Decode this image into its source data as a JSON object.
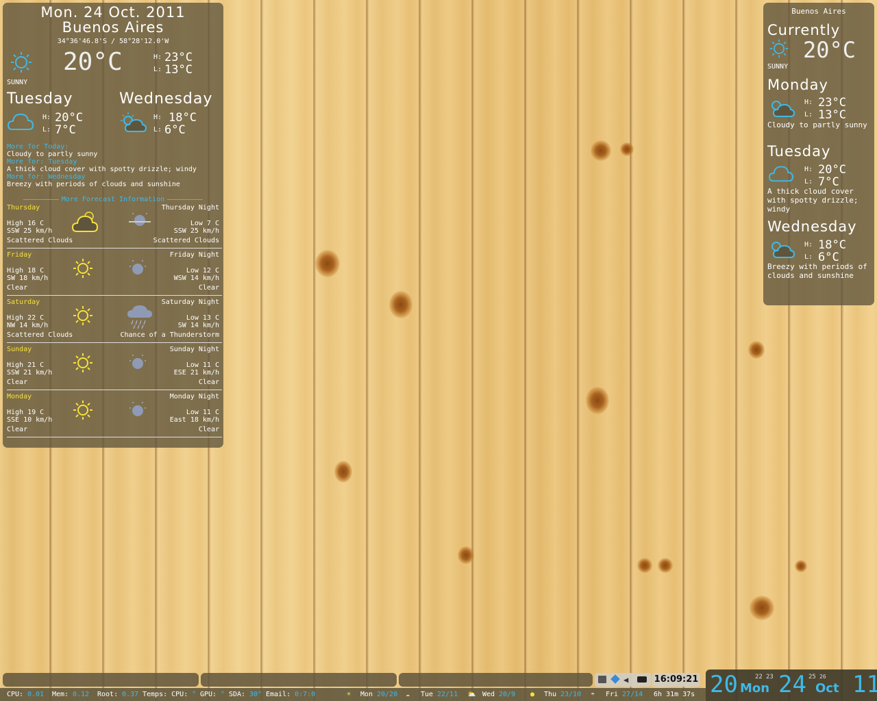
{
  "left": {
    "date": "Mon. 24 Oct. 2011",
    "city": "Buenos Aires",
    "coords": "34°36'46.8'S / 58°28'12.0'W",
    "current_temp": "20°C",
    "current_high": "23°C",
    "current_low": "13°C",
    "current_cond": "SUNNY",
    "h_label": "H:",
    "l_label": "L:",
    "day2": {
      "name": "Tuesday",
      "high": "20°C",
      "low": "7°C"
    },
    "day3": {
      "name": "Wednesday",
      "high": "18°C",
      "low": "6°C"
    },
    "more_today_label": "More for Today:",
    "more_today_text": "Cloudy to partly sunny",
    "more_tue_label": "More for: Tuesday",
    "more_tue_text": "A thick cloud cover with spotty drizzle; windy",
    "more_wed_label": "More for: Wednesday",
    "more_wed_text": "Breezy with periods of clouds and sunshine",
    "more_forecast": "More Forecast Information",
    "forecast": [
      {
        "day": "Thursday",
        "night": "Thursday Night",
        "high": "High 16 C",
        "wind": "SSW 25 km/h",
        "cond": "Scattered Clouds",
        "low": "Low 7 C",
        "nwind": "SSW  25 km/h",
        "ncond": "Scattered Clouds",
        "icon": "cloud-icon",
        "nicon": "moon-cloud-icon"
      },
      {
        "day": "Friday",
        "night": "Friday Night",
        "high": "High 18 C",
        "wind": "SW 18 km/h",
        "cond": "Clear",
        "low": "Low 12 C",
        "nwind": "WSW  14 km/h",
        "ncond": "Clear",
        "icon": "sun-icon",
        "nicon": "moon-icon"
      },
      {
        "day": "Saturday",
        "night": "Saturday Night",
        "high": "High 22 C",
        "wind": "NW 14 km/h",
        "cond": "Scattered Clouds",
        "low": "Low 13 C",
        "nwind": "SW  14 km/h",
        "ncond": "Chance of a Thunderstorm",
        "icon": "sun-icon",
        "nicon": "thunderstorm-icon"
      },
      {
        "day": "Sunday",
        "night": "Sunday Night",
        "high": "High 21 C",
        "wind": "SSW 21 km/h",
        "cond": "Clear",
        "low": "Low 11 C",
        "nwind": "ESE  21 km/h",
        "ncond": "Clear",
        "icon": "sun-icon",
        "nicon": "moon-icon"
      },
      {
        "day": "Monday",
        "night": "Monday Night",
        "high": "High 19 C",
        "wind": "SSE 10 km/h",
        "cond": "Clear",
        "low": "Low 11 C",
        "nwind": "East  18 km/h",
        "ncond": "Clear",
        "icon": "sun-icon",
        "nicon": "moon-icon"
      }
    ]
  },
  "right": {
    "city": "Buenos Aires",
    "currently": "Currently",
    "temp": "20°C",
    "cond": "SUNNY",
    "monday": {
      "name": "Monday",
      "high": "23°C",
      "low": "13°C",
      "text": "Cloudy to partly sunny"
    },
    "tuesday": {
      "name": "Tuesday",
      "high": "20°C",
      "low": "7°C",
      "text": "A thick cloud cover with spotty drizzle; windy"
    },
    "wednesday": {
      "name": "Wednesday",
      "high": "18°C",
      "low": "6°C",
      "text": "Breezy with periods of clouds and sunshine"
    },
    "h_label": "H:",
    "l_label": "L:"
  },
  "status": {
    "cpu_label": "CPU:",
    "cpu": "0.01",
    "mem_label": "Mem:",
    "mem": "0.12",
    "root_label": "Root:",
    "root": "0.37",
    "temps_label": "Temps: CPU:",
    "temps_cpu": "°",
    "gpu_label": "GPU:",
    "gpu": "°",
    "sda_label": "SDA:",
    "sda": "30°",
    "email_label": "Email:",
    "email": "0:7:0",
    "mon_label": "Mon",
    "mon": "20/20",
    "tue_label": "Tue",
    "tue": "22/11",
    "wed_label": "Wed",
    "wed": "20/9",
    "thu_label": "Thu",
    "thu": "23/10",
    "fri_label": "Fri",
    "fri": "27/14",
    "uptime": "6h 31m 37s"
  },
  "tray": {
    "time": "16:09:21"
  },
  "clock": {
    "hour": "20",
    "day_name": "Mon",
    "min_a": "22",
    "min_b": "23",
    "day": "24",
    "sec_a": "25",
    "sec_b": "26",
    "month": "Oct",
    "year": "11"
  },
  "colors": {
    "accent": "#3fb9e8",
    "sun": "#f4e23a",
    "panel": "#5f553c"
  }
}
